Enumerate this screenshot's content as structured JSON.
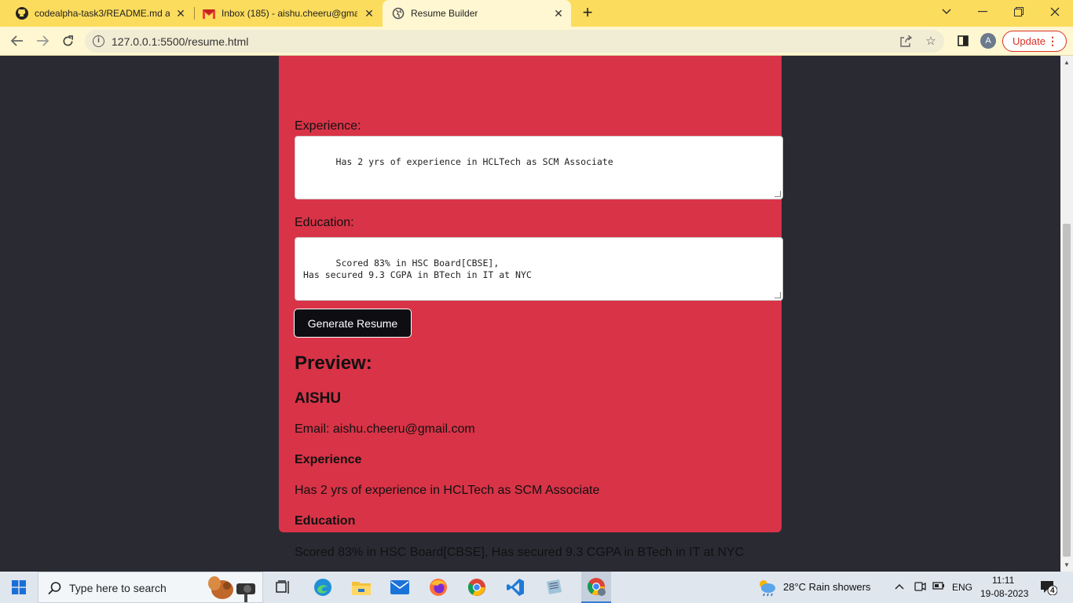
{
  "browser": {
    "tabs": [
      {
        "title": "codealpha-task3/README.md at",
        "icon": "github-icon"
      },
      {
        "title": "Inbox (185) - aishu.cheeru@gmai",
        "icon": "gmail-icon"
      },
      {
        "title": "Resume Builder",
        "icon": "globe-icon",
        "active": true
      }
    ],
    "url": "127.0.0.1:5500/resume.html",
    "profile_initial": "A",
    "update_label": "Update"
  },
  "form": {
    "experience_label": "Experience:",
    "experience_value": "Has 2 yrs of experience in HCLTech as SCM Associate",
    "education_label": "Education:",
    "education_value": "Scored 83% in HSC Board[CBSE],\nHas secured 9.3 CGPA in BTech in IT at NYC",
    "generate_label": "Generate Resume"
  },
  "preview": {
    "heading": "Preview:",
    "name": "AISHU",
    "email": "Email: aishu.cheeru@gmail.com",
    "experience_heading": "Experience",
    "experience_text": "Has 2 yrs of experience in HCLTech as SCM Associate",
    "education_heading": "Education",
    "education_text": "Scored 83% in HSC Board[CBSE], Has secured 9.3 CGPA in BTech in IT at NYC"
  },
  "taskbar": {
    "search_placeholder": "Type here to search",
    "weather": "28°C  Rain showers",
    "language": "ENG",
    "time": "11:11",
    "date": "19-08-2023",
    "notifications": "4"
  },
  "colors": {
    "tab_strip": "#fcdc5c",
    "card": "#d93347",
    "page_bg": "#2a2a33"
  }
}
